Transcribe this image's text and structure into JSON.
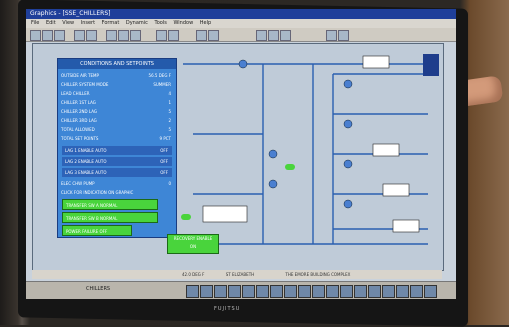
{
  "window": {
    "title": "Graphics - [SSE_CHILLERS]",
    "menu": [
      "File",
      "Edit",
      "View",
      "Insert",
      "Format",
      "Dynamic",
      "Tools",
      "Window",
      "Help"
    ]
  },
  "panel": {
    "title": "CONDITIONS AND SETPOINTS",
    "rows": [
      {
        "label": "OUTSIDE AIR TEMP",
        "value": "56.5 DEG F"
      },
      {
        "label": "CHILLER SYSTEM MODE",
        "value": "SUMMER"
      },
      {
        "label": "LEAD CHILLER",
        "value": "4"
      },
      {
        "label": "CHILLER 1ST LAG",
        "value": "1"
      },
      {
        "label": "CHILLER 2ND LAG",
        "value": "5"
      },
      {
        "label": "CHILLER 3RD LAG",
        "value": "2"
      },
      {
        "label": "TOTAL ALLOWED",
        "value": "5"
      },
      {
        "label": "TOTAL SET POINTS",
        "value": "9 PCT"
      }
    ],
    "lags": [
      {
        "label": "LAG 1 ENABLE",
        "mode": "AUTO",
        "state": "OFF"
      },
      {
        "label": "LAG 2 ENABLE",
        "mode": "AUTO",
        "state": "OFF"
      },
      {
        "label": "LAG 3 ENABLE",
        "mode": "AUTO",
        "state": "OFF"
      }
    ],
    "extra_rows": [
      {
        "label": "ELEC CHW PUMP",
        "value": "0"
      },
      {
        "label": "CLICK FOR INDICATION ON GRAPHIC",
        "value": ""
      }
    ],
    "green_boxes": [
      {
        "label": "TRANSFER SW A",
        "state": "NORMAL"
      },
      {
        "label": "TRANSFER SW B",
        "state": "NORMAL"
      },
      {
        "label": "POWER FAILURE",
        "state": "OFF"
      }
    ]
  },
  "recovery": {
    "line1": "RECOVERY ENABLE",
    "line2": "ON"
  },
  "status": {
    "left": "42.0 DEG F",
    "center": "ST ELIZABETH",
    "right": "THE EMORE BUILDING COMPLEX"
  },
  "taskbar": {
    "item": "CHILLERS"
  },
  "brand": "FUJITSU",
  "icons": [
    "window-icon",
    "toolbar-icons",
    "chiller-icon",
    "pump-icon",
    "valve-icon"
  ]
}
